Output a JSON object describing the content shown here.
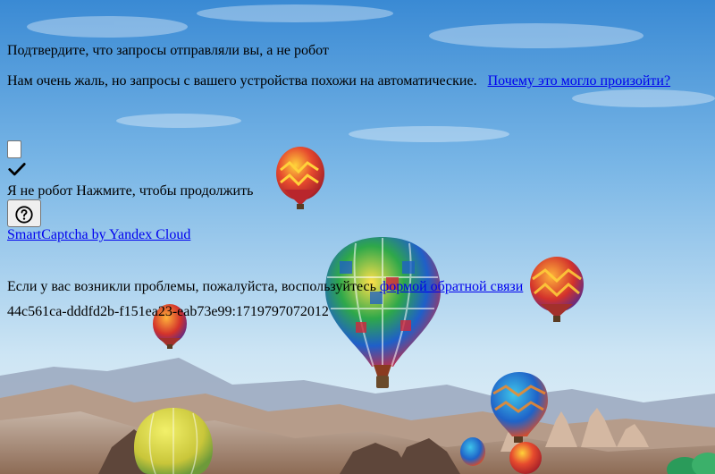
{
  "page": {
    "title": "Подтвердите, что запросы отправляли вы, а не робот",
    "subtitle": "Нам очень жаль, но запросы с вашего устройства похожи на автоматические.",
    "why_link": "Почему это могло произойти?"
  },
  "captcha": {
    "checkbox_checked": false,
    "check_icon": "checkmark-icon",
    "label": "Я не робот",
    "hint": "Нажмите, чтобы продолжить",
    "help_icon": "question-circle-icon",
    "brand": "SmartCaptcha by Yandex Cloud"
  },
  "feedback": {
    "text": "Если у вас возникли проблемы, пожалуйста, воспользуйтесь",
    "link": "формой обратной связи"
  },
  "request_id": "44c561ca-dddfd2b-f151ea23-eab73e99:1719797072012",
  "background": {
    "sky_top": "#3f8fd6",
    "sky_bottom": "#d9ecf6",
    "ground": "#c9a98f",
    "mountains": "#8a9bb5"
  }
}
